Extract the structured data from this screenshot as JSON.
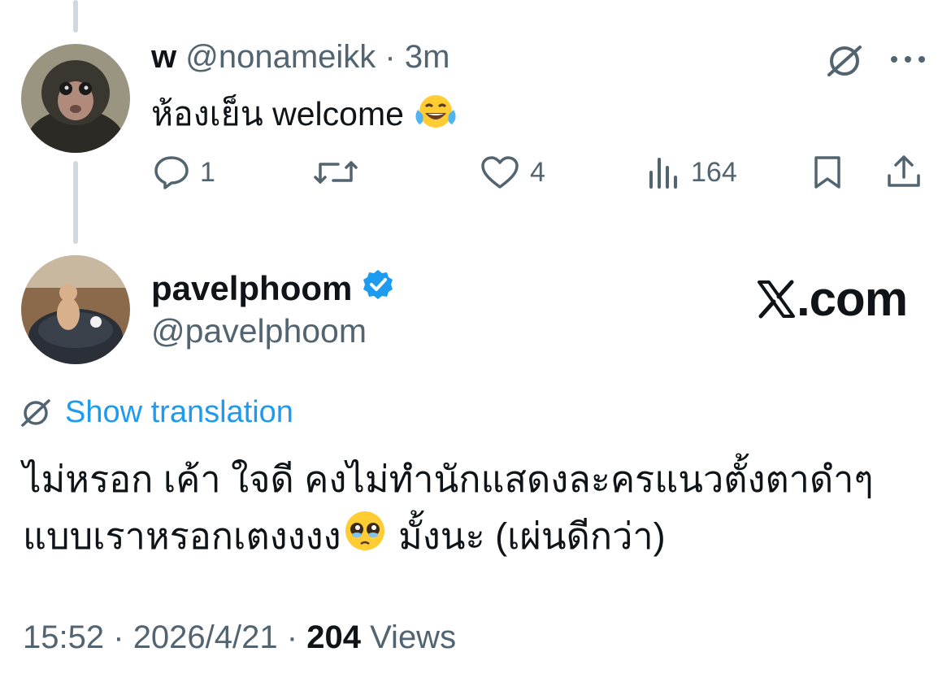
{
  "reply": {
    "display_name": "w",
    "handle": "@nonameikk",
    "separator": "·",
    "time": "3m",
    "text": "ห้องเย็น welcome",
    "emoji": "face-with-tears-of-joy",
    "actions": {
      "reply_count": "1",
      "retweet_count": "",
      "like_count": "4",
      "view_count": "164"
    }
  },
  "main": {
    "display_name": "pavelphoom",
    "handle": "@pavelphoom",
    "verified": true,
    "logo_text": ".com",
    "translate_label": "Show translation",
    "text_line1": "ไม่หรอก เค้า ใจดี คงไม่ทำนักแสดงละครแนวตั้งตาดำๆ",
    "text_line2a": "แบบเราหรอกเตงงงง",
    "text_line2b": " มั้งนะ (เผ่นดีกว่า)",
    "emoji": "pleading-face",
    "time": "15:52",
    "date": "2026/4/21",
    "views_count": "204",
    "views_label": "Views",
    "separator": "·"
  },
  "colors": {
    "text": "#0f1419",
    "muted": "#536471",
    "accent": "#1d9bf0",
    "thread_line": "#cfd9de"
  }
}
